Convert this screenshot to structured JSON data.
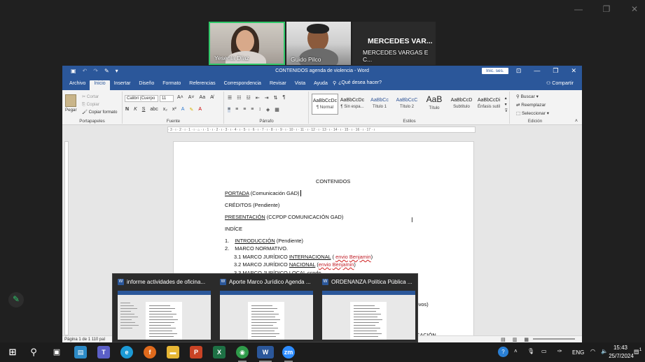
{
  "meeting": {
    "participants": [
      {
        "name": "Yesenia Díaz"
      },
      {
        "name": "Guido Pilco"
      },
      {
        "name": "MERCEDES VARGAS E C...",
        "initials_display": "MERCEDES VAR..."
      }
    ]
  },
  "word": {
    "title": "CONTENIDOS agenda de violencia  -  Word",
    "signin": "Inic. ses.",
    "tabs": [
      "Archivo",
      "Inicio",
      "Insertar",
      "Diseño",
      "Formato",
      "Referencias",
      "Correspondencia",
      "Revisar",
      "Vista",
      "Ayuda"
    ],
    "active_tab": "Inicio",
    "tell_me": "¿Qué desea hacer?",
    "share": "Compartir",
    "clipboard": {
      "paste": "Pegar",
      "cut": "Cortar",
      "copy": "Copiar",
      "format_painter": "Copiar formato",
      "label": "Portapapeles"
    },
    "font": {
      "name": "Calibri (Cuerpo",
      "size": "11",
      "label": "Fuente"
    },
    "paragraph_label": "Párrafo",
    "styles": {
      "label": "Estilos",
      "items": [
        {
          "sample": "AaBbCcDc",
          "name": "¶ Normal"
        },
        {
          "sample": "AaBbCcDc",
          "name": "¶ Sin espa..."
        },
        {
          "sample": "AaBbCc",
          "name": "Título 1"
        },
        {
          "sample": "AaBbCcC",
          "name": "Título 2"
        },
        {
          "sample": "AaB",
          "name": "Título"
        },
        {
          "sample": "AaBbCcD",
          "name": "Subtítulo"
        },
        {
          "sample": "AaBbCcDi",
          "name": "Énfasis sutil"
        }
      ]
    },
    "editing": {
      "find": "Buscar",
      "replace": "Reemplazar",
      "select": "Seleccionar",
      "label": "Edición"
    },
    "ruler_text": "· 3 · ı · 2 · ı · 1 · ı · ⌂ · ı · 1 · ı · 2 · ı · 3 · ı · 4 · ı · 5 · ı · 6 · ı · 7 · ı · 8 · ı · 9 · ı · 10 · ı · 11 · ı · 12 · ı · 13 · ı · 14 · ı · 15 · ı · 16 · ı · 17 · ı",
    "document": {
      "heading": "CONTENIDOS",
      "portada_a": "PORTADA",
      "portada_b": "  (Comunicación GAD)",
      "creditos": "CRÉDITOS   (Pendiente)",
      "presentacion_a": "PRESENTACIÓN",
      "presentacion_b": "  (CCPDP COMUNICACIÓN GAD)",
      "indice": "INDÍCE",
      "item1_num": "1.",
      "item1_a": "INTRODUCCIÓN",
      "item1_b": "  (Pendiente)",
      "item2_num": "2.",
      "item2": "MARCO NORMATIVO.",
      "sub1_a": "3.1 MARCO JURÍDICO ",
      "sub1_b": "INTERNACIONAL",
      "sub1_c": "  ( ",
      "sub1_d": "envio",
      "sub1_e": " ",
      "sub1_f": "Benjamin",
      "sub1_g": ")",
      "sub2_a": "3.2 MARCO JURÍDICO ",
      "sub2_b": "NACIONAL",
      "sub2_c": "  (",
      "sub2_d": "envio",
      "sub2_e": " ",
      "sub2_f": "Benjamin",
      "sub2_g": ")",
      "sub3": "3.3 MARCO JURÍDICO LOCAL ccpdp",
      "right_frag1": "tivos)",
      "right_frag2": "CACIÓN"
    },
    "status": {
      "page": "Página 1 de 1",
      "words": "110 pal"
    }
  },
  "previews": [
    {
      "title": "informe actividades de oficina..."
    },
    {
      "title": "Aporte Marco Jurídico Agenda ..."
    },
    {
      "title": "ORDENANZA  Política Pública ..."
    }
  ],
  "tray": {
    "lang": "ENG",
    "time": "15:43",
    "date": "25/7/2024",
    "notifications": "1"
  },
  "colors": {
    "word_blue": "#2b579a",
    "active_speaker": "#31c86a",
    "taskbar": "#1c1c1c"
  }
}
